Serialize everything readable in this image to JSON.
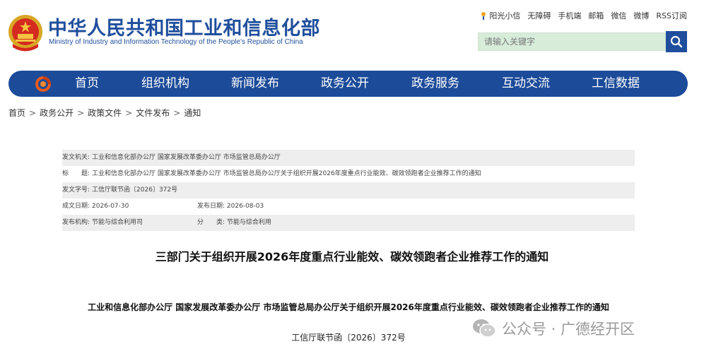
{
  "header": {
    "title_zh": "中华人民共和国工业和信息化部",
    "title_en": "Ministry of Industry and Information Technology of the People's Republic of China",
    "top_links": [
      "阳光小信",
      "无障碍",
      "手机端",
      "邮箱",
      "微信",
      "微博",
      "RSS订阅"
    ],
    "search_placeholder": "请输入关键字"
  },
  "nav": {
    "items": [
      "首页",
      "组织机构",
      "新闻发布",
      "政务公开",
      "政务服务",
      "互动交流",
      "工信数据"
    ]
  },
  "breadcrumb": [
    "首页",
    "政务公开",
    "政策文件",
    "文件发布",
    "通知"
  ],
  "info": {
    "issuer_label": "发文机关:",
    "issuer": "工业和信息化部办公厅 国家发展改革委办公厅 市场监管总局办公厅",
    "title_label": "标　　题:",
    "title": "工业和信息化部办公厅 国家发展改革委办公厅 市场监管总局办公厅关于组织开展2026年度重点行业能效、碳效领跑者企业推荐工作的通知",
    "docno_label": "发文字号:",
    "docno": "工信厅联节函〔2026〕372号",
    "created_label": "成文日期:",
    "created": "2026-07-30",
    "published_label": "发布日期:",
    "published": "2026-08-03",
    "agency_label": "发布机构:",
    "agency": "节能与综合利用司",
    "category_label": "分　　类:",
    "category": "节能与综合利用"
  },
  "article": {
    "title": "三部门关于组织开展2026年度重点行业能效、碳效领跑者企业推荐工作的通知",
    "subtitle": "工业和信息化部办公厅  国家发展改革委办公厅  市场监管总局办公厅关于组织开展2026年度重点行业能效、碳效领跑者企业推荐工作的通知",
    "doc_number": "工信厅联节函〔2026〕372号"
  },
  "watermark": {
    "text": "公众号 · 广德经开区"
  },
  "colors": {
    "brand_blue": "#1c4b99",
    "search_bg": "#d7ecd9",
    "row_shade": "#eeeeee"
  }
}
